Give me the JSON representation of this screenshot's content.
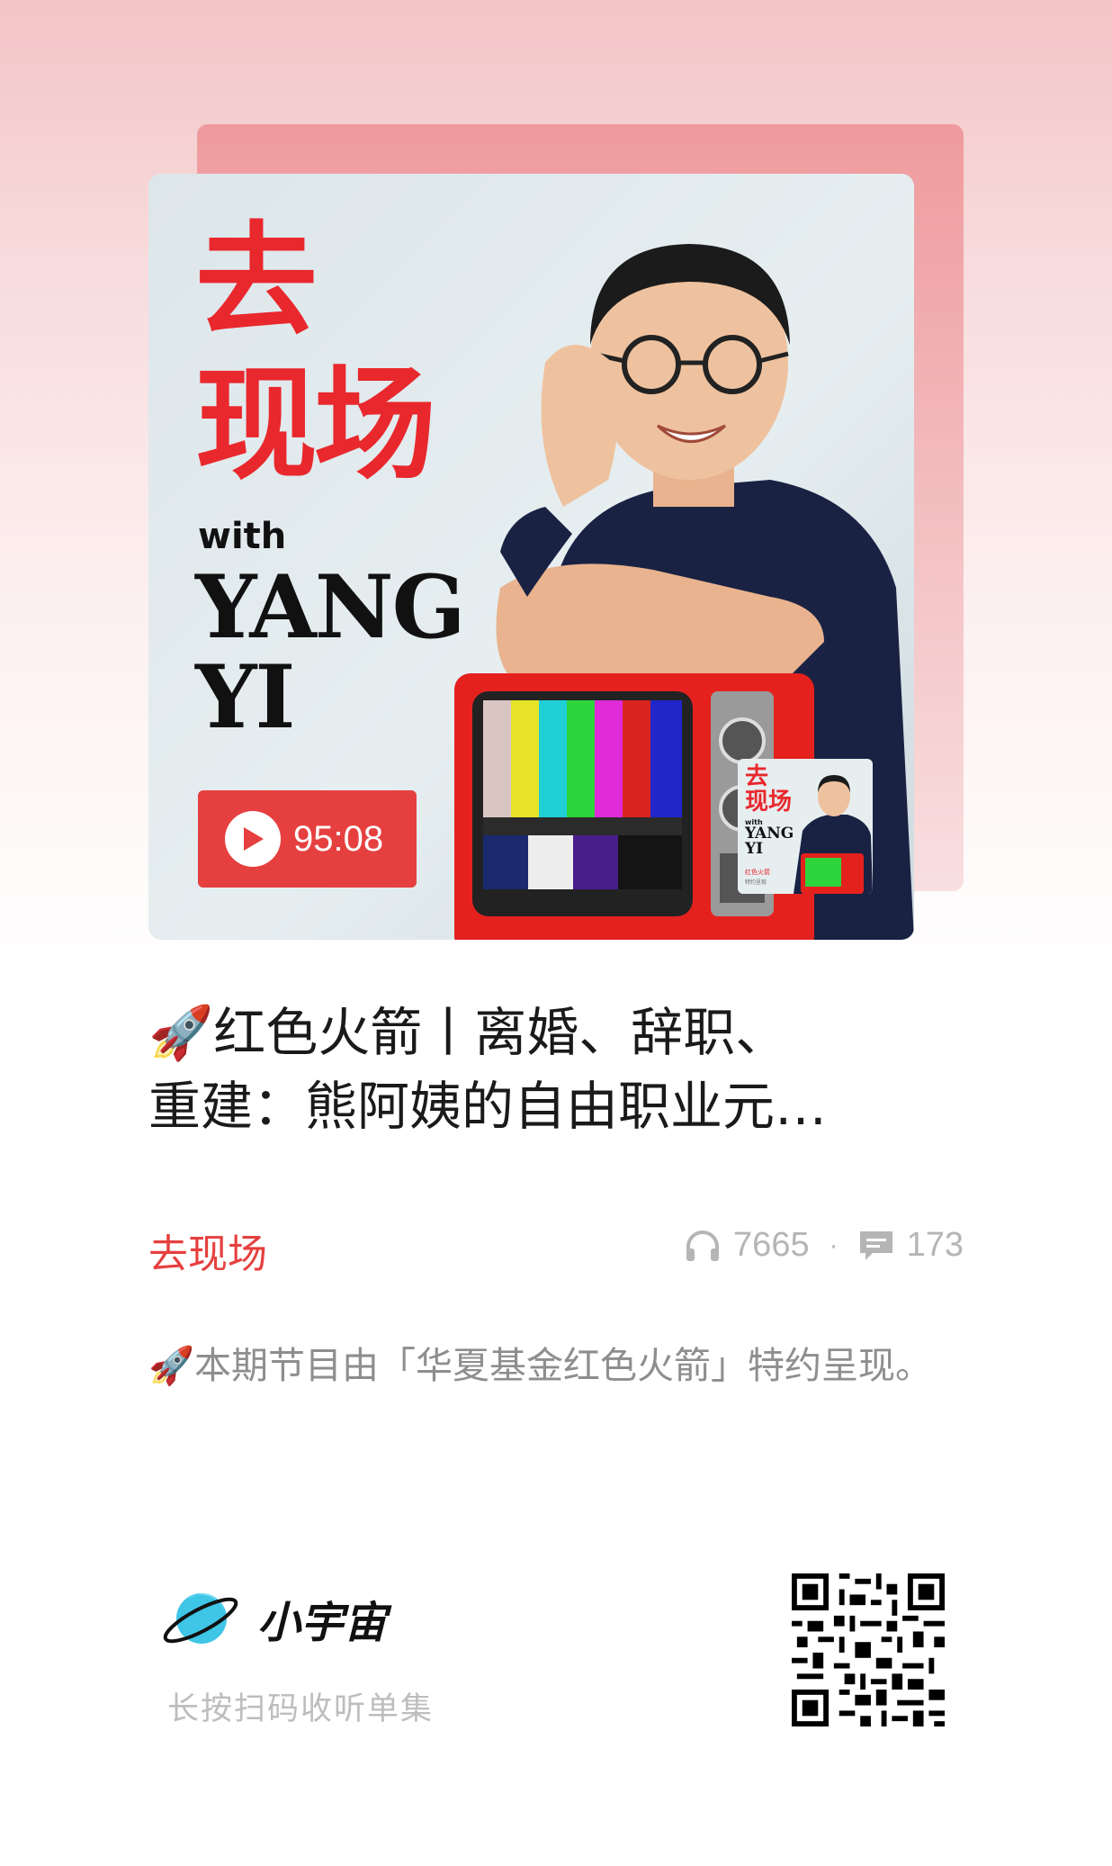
{
  "cover": {
    "title_cn_line1": "去",
    "title_cn_line2": "现场",
    "with": "with",
    "name_line1": "YANG",
    "name_line2": "YI",
    "duration": "95:08",
    "mini_title1": "去",
    "mini_title2": "现场",
    "mini_with": "with",
    "mini_name1": "YANG",
    "mini_name2": "YI",
    "mini_badge": "红色火箭",
    "mini_sub": "特约呈现"
  },
  "episode": {
    "title_line1": "🚀红色火箭丨离婚、辞职、",
    "title_line2": "重建：熊阿姨的自由职业元…",
    "podcast": "去现场",
    "plays": "7665",
    "separator": "·",
    "comments": "173",
    "description": "🚀本期节目由「华夏基金红色火箭」特约呈现。"
  },
  "footer": {
    "brand": "小宇宙",
    "hint": "长按扫码收听单集"
  },
  "colors": {
    "accent": "#e5403f",
    "title_red": "#e8282d",
    "stat_gray": "#b5b5b5"
  }
}
